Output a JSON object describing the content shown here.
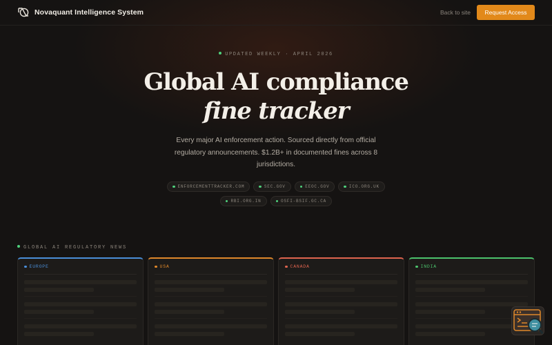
{
  "header": {
    "brand": "Novaquant Intelligence System",
    "back_link": "Back to site",
    "cta": "Request Access"
  },
  "hero": {
    "badge": "UPDATED WEEKLY · APRIL 2026",
    "title_line1": "Global AI compliance",
    "title_line2": "fine tracker",
    "description": "Every major AI enforcement action. Sourced directly from official regulatory announcements. $1.2B+ in documented fines across 8 jurisdictions.",
    "sources": [
      "ENFORCEMENTTRACKER.COM",
      "SEC.GOV",
      "EEOC.GOV",
      "ICO.ORG.UK",
      "RBI.ORG.IN",
      "OSFI-BSIF.GC.CA"
    ]
  },
  "news": {
    "section_label": "GLOBAL AI REGULATORY NEWS",
    "regions": [
      {
        "name": "EUROPE",
        "color": "#4a8fd9"
      },
      {
        "name": "USA",
        "color": "#e0882a"
      },
      {
        "name": "CANADA",
        "color": "#e0644f"
      },
      {
        "name": "INDIA",
        "color": "#4cc46c"
      }
    ]
  },
  "colors": {
    "accent": "#e2891a",
    "live_dot": "#4fd07c",
    "background": "#151312"
  },
  "icons": {
    "brand": "novaquant-logo-icon",
    "widget": "search-document-icon"
  }
}
